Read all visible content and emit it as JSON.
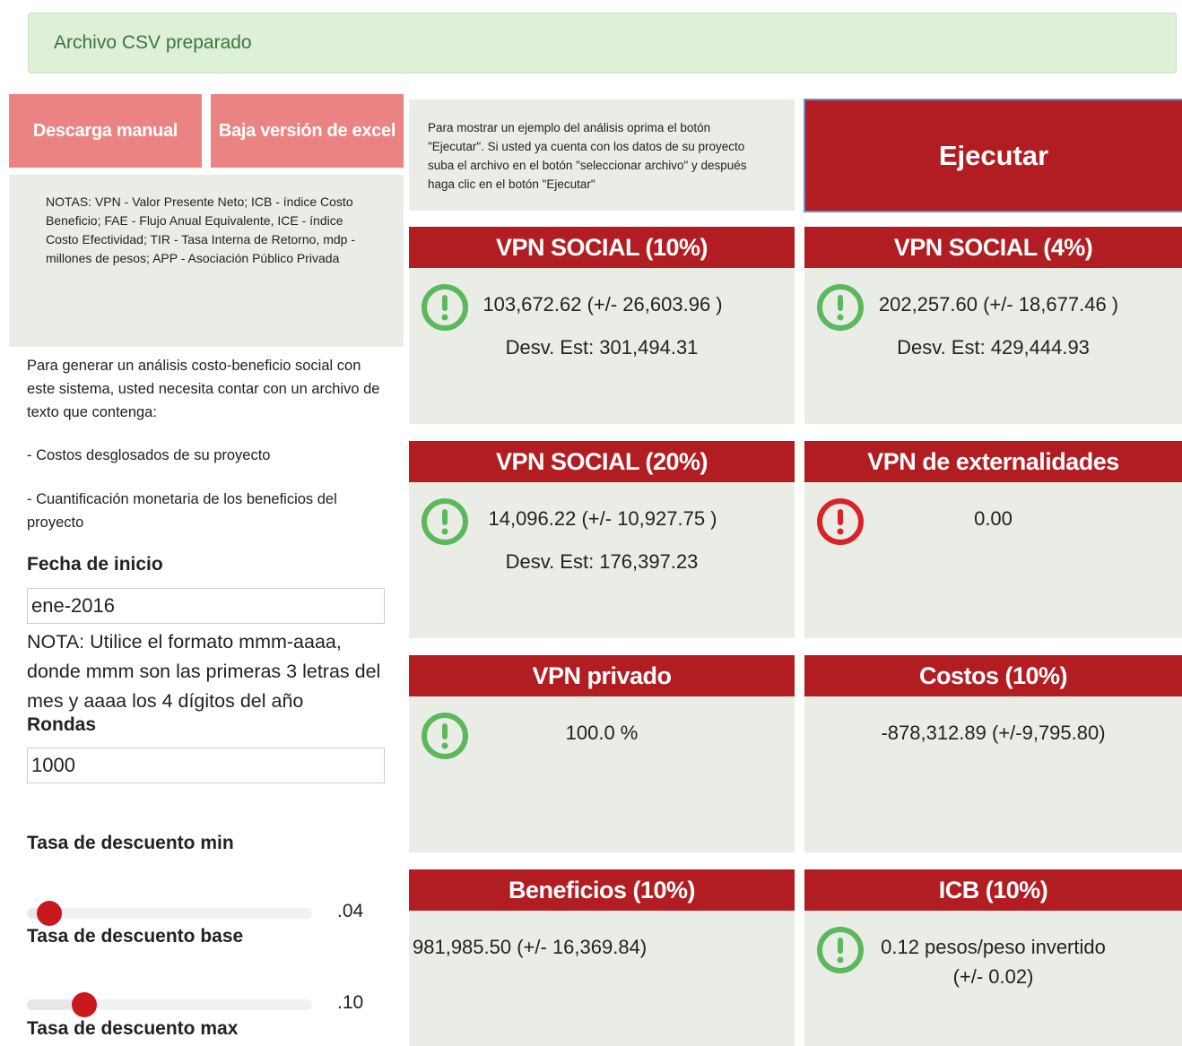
{
  "alert": {
    "text": "Archivo CSV preparado"
  },
  "buttons": {
    "manual_download": "Descarga manual",
    "excel_download": "Baja versión de excel",
    "run": "Ejecutar"
  },
  "notes": {
    "text": "NOTAS: VPN - Valor Presente Neto; ICB - índice Costo Beneficio; FAE - Flujo Anual Equivalente, ICE - índice Costo Efectividad; TIR - Tasa Interna de Retorno, mdp - millones de pesos; APP - Asociación Público Privada"
  },
  "info": {
    "text": "Para mostrar un ejemplo del análisis oprima el botón \"Ejecutar\". Si usted ya cuenta con los datos de su proyecto suba el archivo en el botón \"seleccionar archivo\" y después haga clic en el botón \"Ejecutar\""
  },
  "intro": {
    "paragraph": "Para generar un análisis costo-beneficio social con este sistema, usted necesita contar con un archivo de texto que contenga:",
    "bullet1": "- Costos desglosados de su proyecto",
    "bullet2": "- Cuantificación monetaria de los beneficios del proyecto"
  },
  "form": {
    "start_date_label": "Fecha de inicio",
    "start_date_value": "ene-2016",
    "date_note": "NOTA: Utilice el formato mmm-aaaa, donde mmm son las primeras 3 letras del mes y aaaa los 4 dígitos del año",
    "rounds_label": "Rondas",
    "rounds_value": "1000",
    "rate_min_label": "Tasa de descuento min",
    "rate_min_value": ".04",
    "rate_min_fraction": 0.04,
    "rate_base_label": "Tasa de descuento base",
    "rate_base_value": ".10",
    "rate_base_fraction": 0.1,
    "rate_max_label": "Tasa de descuento max"
  },
  "colors": {
    "header_red": "#b21d22",
    "pink": "#ec8383",
    "panel": "#e9ede6",
    "ok_green": "#5cb85c",
    "error_red": "#d9232b"
  },
  "cards": [
    {
      "title": "VPN SOCIAL (10%)",
      "icon": "exclamation-circle-green-icon",
      "value": "103,672.62 (+/- 26,603.96 )",
      "sub": "Desv. Est: 301,494.31"
    },
    {
      "title": "VPN SOCIAL (4%)",
      "icon": "exclamation-circle-green-icon",
      "value": "202,257.60 (+/- 18,677.46 )",
      "sub": "Desv. Est: 429,444.93"
    },
    {
      "title": "VPN SOCIAL (20%)",
      "icon": "exclamation-circle-green-icon",
      "value": "14,096.22 (+/- 10,927.75 )",
      "sub": "Desv. Est: 176,397.23"
    },
    {
      "title": "VPN de externalidades",
      "icon": "exclamation-circle-red-icon",
      "value": "0.00"
    },
    {
      "title": "VPN privado",
      "icon": "exclamation-circle-green-icon",
      "value": "100.0 %"
    },
    {
      "title": "Costos (10%)",
      "value": "-878,312.89 (+/-9,795.80)"
    },
    {
      "title": "Beneficios (10%)",
      "value": "981,985.50 (+/- 16,369.84)"
    },
    {
      "title": "ICB (10%)",
      "icon": "exclamation-circle-green-icon",
      "value": "0.12 pesos/peso invertido",
      "sub": "(+/- 0.02)"
    }
  ]
}
